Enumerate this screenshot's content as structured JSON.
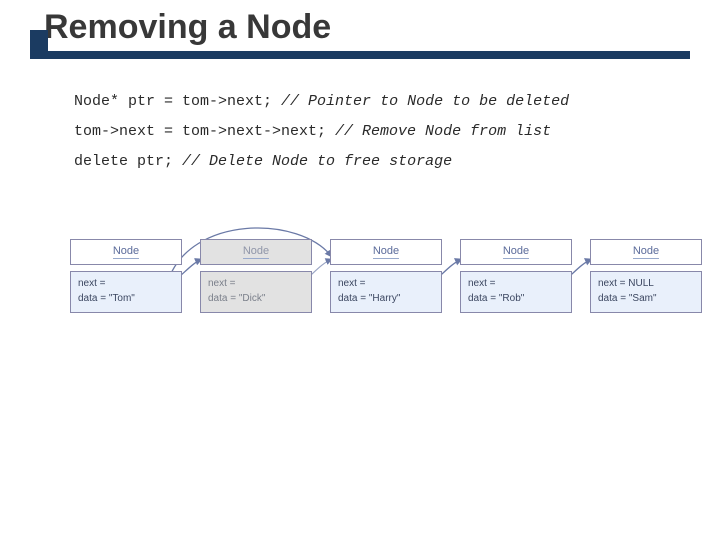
{
  "title": "Removing a Node",
  "code": {
    "line1_code": "Node* ptr = tom->next; ",
    "line1_comment": "// Pointer to Node to be deleted",
    "line2_code": "tom->next = tom->next->next; ",
    "line2_comment": "// Remove Node from list",
    "line3_code": "delete ptr; ",
    "line3_comment": "// Delete Node to free storage"
  },
  "node_label": "Node",
  "nodes": [
    {
      "next": "next =",
      "data": "data = \"Tom\"",
      "dim": false
    },
    {
      "next": "next =",
      "data": "data = \"Dick\"",
      "dim": true
    },
    {
      "next": "next =",
      "data": "data = \"Harry\"",
      "dim": false
    },
    {
      "next": "next =",
      "data": "data = \"Rob\"",
      "dim": false
    },
    {
      "next": "next = NULL",
      "data": "data = \"Sam\"",
      "dim": false
    }
  ]
}
